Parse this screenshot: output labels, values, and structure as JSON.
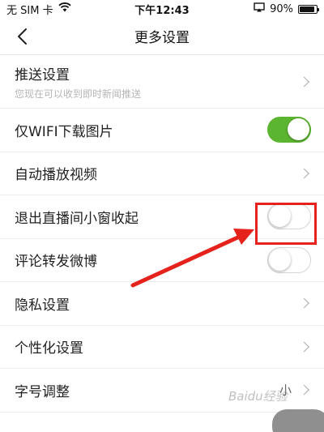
{
  "status_bar": {
    "carrier": "无 SIM 卡",
    "time": "下午12:43",
    "battery_text": "90%",
    "battery_level": 0.9,
    "icons": [
      "wifi-icon",
      "screen-mirroring-icon",
      "battery-icon"
    ]
  },
  "nav": {
    "title": "更多设置",
    "back_icon": "chevron-left-icon"
  },
  "settings": [
    {
      "label": "推送设置",
      "subtitle": "您现在可以收到即时新闻推送",
      "control": "chevron"
    },
    {
      "label": "仅WIFI下载图片",
      "control": "toggle",
      "on": true
    },
    {
      "label": "自动播放视频",
      "control": "chevron"
    },
    {
      "label": "退出直播间小窗收起",
      "control": "toggle",
      "on": false,
      "highlighted": true
    },
    {
      "label": "评论转发微博",
      "control": "toggle",
      "on": false
    },
    {
      "label": "隐私设置",
      "control": "chevron"
    },
    {
      "label": "个性化设置",
      "control": "chevron"
    },
    {
      "label": "字号调整",
      "value": "小",
      "control": "chevron"
    }
  ],
  "colors": {
    "toggle_on": "#5cb531",
    "annotation_red": "#e5231c"
  },
  "watermark": "Baidu经验"
}
